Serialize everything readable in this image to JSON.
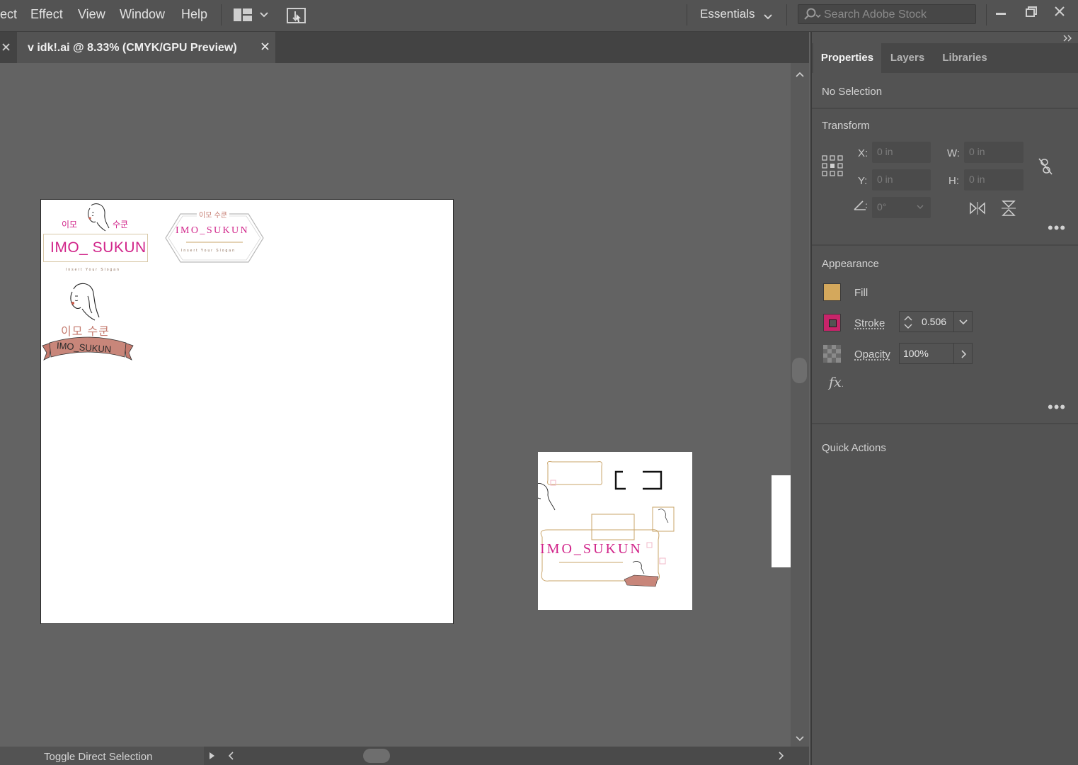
{
  "menu": {
    "items": [
      "ect",
      "Effect",
      "View",
      "Window",
      "Help"
    ],
    "workspace": "Essentials",
    "search_placeholder": "Search Adobe Stock"
  },
  "document_tab": {
    "title": "v idk!.ai @ 8.33% (CMYK/GPU Preview)"
  },
  "status_bar": {
    "tool": "Toggle Direct Selection"
  },
  "artwork": {
    "korean": "이모 수쿤",
    "ko_left": "이모",
    "ko_right": "수쿤",
    "brand_a": "IMO_ SUKUN",
    "brand_b": "IMO_SUKUN",
    "slogan": "Insert Your Slogan"
  },
  "panel": {
    "tabs": [
      "Properties",
      "Layers",
      "Libraries"
    ],
    "selection": "No Selection",
    "transform": {
      "title": "Transform",
      "x_label": "X:",
      "x_value": "0 in",
      "y_label": "Y:",
      "y_value": "0 in",
      "w_label": "W:",
      "w_value": "0 in",
      "h_label": "H:",
      "h_value": "0 in",
      "angle_value": "0°"
    },
    "appearance": {
      "title": "Appearance",
      "fill_label": "Fill",
      "stroke_label": "Stroke",
      "stroke_value": "0.506",
      "opacity_label": "Opacity",
      "opacity_value": "100%",
      "fill_color": "#d4a85c",
      "stroke_color": "#c8246a"
    },
    "quick_actions": "Quick Actions"
  },
  "colors": {
    "brand_magenta": "#d1258a",
    "brand_rose": "#c47a6e",
    "brand_gold": "#c9a46a"
  }
}
